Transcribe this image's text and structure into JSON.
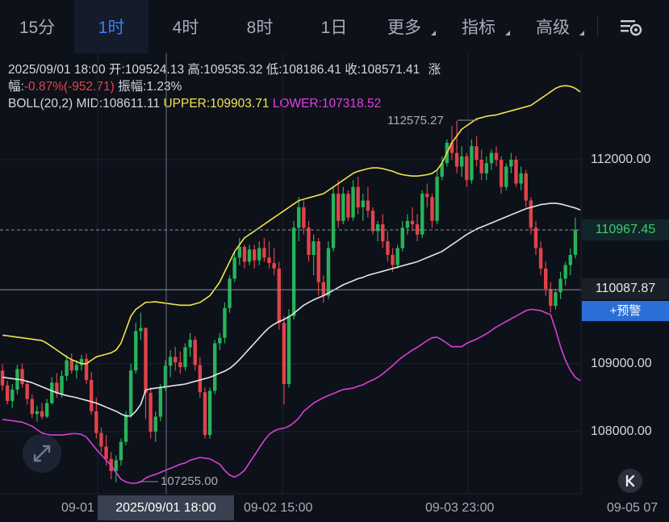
{
  "timeframes": [
    {
      "label": "15分",
      "active": false
    },
    {
      "label": "1时",
      "active": true
    },
    {
      "label": "4时",
      "active": false
    },
    {
      "label": "8时",
      "active": false
    },
    {
      "label": "1日",
      "active": false
    },
    {
      "label": "更多",
      "active": false,
      "dropdown": true
    },
    {
      "label": "指标",
      "active": false,
      "dropdown": true
    },
    {
      "label": "高级",
      "active": false,
      "dropdown": true
    }
  ],
  "info": {
    "line1_datetime": "2025/09/01 18:00",
    "open_label": "开:",
    "open": "109524.13",
    "high_label": "高:",
    "high": "109535.32",
    "low_label": "低:",
    "low": "108186.41",
    "close_label": "收:",
    "close": "108571.41",
    "change_label_a": "涨",
    "change_label_b": "幅:",
    "change_value": "-0.87%(-952.71)",
    "amplitude_label": "振幅:",
    "amplitude": "1.23%",
    "boll_label": "BOLL(20,2)",
    "mid_label": "MID:",
    "mid": "108611.11",
    "upper_label": "UPPER:",
    "upper": "109903.71",
    "lower_label": "LOWER:",
    "lower": "107318.52"
  },
  "price_tags": {
    "current": "110967.45",
    "crosshair": "110087.87",
    "alert_button": "+预警"
  },
  "chart_data": {
    "type": "candlestick",
    "y_ticks": [
      "112000.00",
      "109000.00",
      "108000.00"
    ],
    "y_tick_values": [
      112000,
      109000,
      108000
    ],
    "x_ticks": [
      "09-01",
      "09-02 15:00",
      "09-03 23:00",
      "09-05 07"
    ],
    "crosshair_x_label": "2025/09/01 18:00",
    "high_mark": "112575.27",
    "low_mark": "107255.00",
    "ylim": [
      107180,
      113200
    ],
    "colors": {
      "up": "#26b35a",
      "down": "#e0434a",
      "mid": "#e6e6e6",
      "upper": "#f2e44a",
      "lower": "#d93fd6",
      "grid": "#1e2430"
    },
    "candles": [
      [
        108900,
        108990,
        108600,
        108680
      ],
      [
        108680,
        108750,
        108400,
        108450
      ],
      [
        108450,
        108700,
        108350,
        108620
      ],
      [
        108620,
        108980,
        108550,
        108920
      ],
      [
        108920,
        109000,
        108650,
        108700
      ],
      [
        108700,
        108750,
        108400,
        108480
      ],
      [
        108480,
        108550,
        108200,
        108260
      ],
      [
        108260,
        108380,
        108150,
        108300
      ],
      [
        108300,
        108420,
        108180,
        108220
      ],
      [
        108220,
        108480,
        108200,
        108420
      ],
      [
        108420,
        108800,
        108400,
        108720
      ],
      [
        108720,
        108860,
        108500,
        108560
      ],
      [
        108560,
        108900,
        108500,
        108820
      ],
      [
        108820,
        109130,
        108750,
        109050
      ],
      [
        109050,
        109150,
        108850,
        108900
      ],
      [
        108900,
        109050,
        108780,
        108980
      ],
      [
        108980,
        109130,
        108900,
        109070
      ],
      [
        109070,
        109150,
        108700,
        108760
      ],
      [
        108760,
        108880,
        108250,
        108300
      ],
      [
        108300,
        108500,
        107900,
        107980
      ],
      [
        107980,
        108060,
        107700,
        107780
      ],
      [
        107780,
        107950,
        107500,
        107600
      ],
      [
        107600,
        107700,
        107300,
        107420
      ],
      [
        107420,
        107650,
        107255,
        107580
      ],
      [
        107580,
        107900,
        107500,
        107850
      ],
      [
        107850,
        108300,
        107800,
        108250
      ],
      [
        108250,
        109000,
        108200,
        108900
      ],
      [
        108900,
        109600,
        108850,
        109480
      ],
      [
        109480,
        109750,
        109350,
        109524
      ],
      [
        109524,
        109535,
        108186,
        108571
      ],
      [
        108571,
        108650,
        107900,
        108000
      ],
      [
        108000,
        108300,
        107850,
        108220
      ],
      [
        108220,
        108700,
        108150,
        108640
      ],
      [
        108640,
        109050,
        108600,
        108970
      ],
      [
        108970,
        109200,
        108800,
        109100
      ],
      [
        109100,
        109250,
        108900,
        109020
      ],
      [
        109020,
        109180,
        108850,
        108950
      ],
      [
        108950,
        109300,
        108900,
        109240
      ],
      [
        109240,
        109450,
        109100,
        109350
      ],
      [
        109350,
        109400,
        108900,
        108980
      ],
      [
        108980,
        109100,
        108500,
        108580
      ],
      [
        108580,
        108650,
        107900,
        107950
      ],
      [
        107950,
        108650,
        107900,
        108600
      ],
      [
        108600,
        109350,
        108550,
        109300
      ],
      [
        109300,
        109450,
        109200,
        109380
      ],
      [
        109380,
        109900,
        109300,
        109820
      ],
      [
        109820,
        110300,
        109750,
        110250
      ],
      [
        110250,
        110650,
        110200,
        110560
      ],
      [
        110560,
        110850,
        110450,
        110720
      ],
      [
        110720,
        110750,
        110400,
        110500
      ],
      [
        110500,
        110750,
        110450,
        110680
      ],
      [
        110680,
        110750,
        110400,
        110520
      ],
      [
        110520,
        110800,
        110450,
        110700
      ],
      [
        110700,
        110850,
        110500,
        110560
      ],
      [
        110560,
        110800,
        110400,
        110480
      ],
      [
        110480,
        110700,
        110300,
        110400
      ],
      [
        110400,
        110500,
        109500,
        109600
      ],
      [
        109600,
        109700,
        108400,
        108700
      ],
      [
        108700,
        109800,
        108650,
        109700
      ],
      [
        109700,
        111100,
        109650,
        111000
      ],
      [
        111000,
        111450,
        110800,
        111300
      ],
      [
        111300,
        111400,
        110900,
        111000
      ],
      [
        111000,
        111100,
        110500,
        110600
      ],
      [
        110600,
        110900,
        110300,
        110800
      ],
      [
        110800,
        110850,
        110000,
        110200
      ],
      [
        110200,
        110300,
        109900,
        110000
      ],
      [
        110000,
        110800,
        109950,
        110700
      ],
      [
        110700,
        111600,
        110650,
        111500
      ],
      [
        111500,
        111700,
        111000,
        111100
      ],
      [
        111100,
        111600,
        111050,
        111500
      ],
      [
        111500,
        111550,
        111100,
        111150
      ],
      [
        111150,
        111700,
        111100,
        111600
      ],
      [
        111600,
        111750,
        111200,
        111300
      ],
      [
        111300,
        111500,
        111100,
        111400
      ],
      [
        111400,
        111600,
        111150,
        111250
      ],
      [
        111250,
        111300,
        110900,
        110950
      ],
      [
        110950,
        111100,
        110800,
        111050
      ],
      [
        111050,
        111200,
        110700,
        110800
      ],
      [
        110800,
        110950,
        110500,
        110600
      ],
      [
        110600,
        110700,
        110350,
        110450
      ],
      [
        110450,
        110750,
        110400,
        110700
      ],
      [
        110700,
        111100,
        110650,
        111000
      ],
      [
        111000,
        111200,
        110900,
        111100
      ],
      [
        111100,
        111300,
        110950,
        111050
      ],
      [
        111050,
        111200,
        110800,
        110900
      ],
      [
        110900,
        111550,
        110850,
        111500
      ],
      [
        111500,
        111650,
        111300,
        111450
      ],
      [
        111450,
        111500,
        111000,
        111100
      ],
      [
        111100,
        111850,
        111050,
        111750
      ],
      [
        111750,
        112050,
        111700,
        111950
      ],
      [
        111950,
        112300,
        111900,
        112250
      ],
      [
        112250,
        112500,
        112000,
        112100
      ],
      [
        112100,
        112575,
        111800,
        111900
      ],
      [
        111900,
        112200,
        111750,
        112050
      ],
      [
        112050,
        112100,
        111600,
        111700
      ],
      [
        111700,
        112300,
        111650,
        112200
      ],
      [
        112200,
        112350,
        111900,
        112000
      ],
      [
        112000,
        112150,
        111700,
        111800
      ],
      [
        111800,
        112050,
        111700,
        111950
      ],
      [
        111950,
        112150,
        111850,
        112100
      ],
      [
        112100,
        112200,
        111900,
        112000
      ],
      [
        112000,
        112050,
        111500,
        111600
      ],
      [
        111600,
        111950,
        111550,
        111900
      ],
      [
        111900,
        112100,
        111800,
        112000
      ],
      [
        112000,
        112050,
        111600,
        111650
      ],
      [
        111650,
        111900,
        111550,
        111800
      ],
      [
        111800,
        111850,
        111300,
        111400
      ],
      [
        111400,
        111450,
        110900,
        111000
      ],
      [
        111000,
        111100,
        110600,
        110700
      ],
      [
        110700,
        110800,
        110300,
        110400
      ],
      [
        110400,
        110500,
        110000,
        110100
      ],
      [
        110100,
        110200,
        109750,
        109850
      ],
      [
        109850,
        110100,
        109800,
        110050
      ],
      [
        110050,
        110350,
        109950,
        110250
      ],
      [
        110250,
        110500,
        110150,
        110450
      ],
      [
        110450,
        110700,
        110300,
        110600
      ],
      [
        110600,
        111150,
        110550,
        110967
      ]
    ],
    "mid": [
      108800,
      108790,
      108780,
      108770,
      108760,
      108740,
      108720,
      108690,
      108660,
      108630,
      108600,
      108575,
      108550,
      108530,
      108515,
      108500,
      108480,
      108460,
      108440,
      108420,
      108390,
      108360,
      108330,
      108300,
      108260,
      108230,
      108230,
      108300,
      108400,
      108611,
      108630,
      108640,
      108650,
      108660,
      108670,
      108680,
      108690,
      108700,
      108720,
      108740,
      108760,
      108780,
      108800,
      108830,
      108860,
      108890,
      108930,
      108990,
      109060,
      109140,
      109220,
      109300,
      109380,
      109460,
      109530,
      109580,
      109620,
      109650,
      109690,
      109740,
      109800,
      109860,
      109900,
      109940,
      109970,
      110000,
      110040,
      110080,
      110120,
      110160,
      110190,
      110220,
      110250,
      110270,
      110300,
      110320,
      110340,
      110360,
      110380,
      110400,
      110420,
      110440,
      110460,
      110480,
      110500,
      110530,
      110560,
      110590,
      110620,
      110650,
      110700,
      110750,
      110800,
      110850,
      110900,
      110940,
      110980,
      111010,
      111040,
      111070,
      111100,
      111130,
      111160,
      111190,
      111220,
      111250,
      111280,
      111300,
      111320,
      111340,
      111350,
      111360,
      111360,
      111350,
      111330,
      111310,
      111290,
      111260
    ],
    "upper": [
      109420,
      109410,
      109400,
      109390,
      109380,
      109370,
      109360,
      109350,
      109340,
      109300,
      109250,
      109200,
      109150,
      109100,
      109060,
      109030,
      109000,
      109000,
      109050,
      109100,
      109120,
      109140,
      109160,
      109200,
      109300,
      109500,
      109700,
      109800,
      109850,
      109903,
      109905,
      109910,
      109900,
      109890,
      109880,
      109870,
      109860,
      109860,
      109860,
      109880,
      109900,
      109950,
      110000,
      110100,
      110200,
      110350,
      110500,
      110650,
      110750,
      110850,
      110900,
      110950,
      111000,
      111050,
      111100,
      111150,
      111200,
      111250,
      111300,
      111350,
      111400,
      111420,
      111440,
      111460,
      111480,
      111500,
      111550,
      111600,
      111650,
      111700,
      111750,
      111800,
      111830,
      111850,
      111870,
      111880,
      111880,
      111870,
      111850,
      111830,
      111800,
      111780,
      111770,
      111760,
      111760,
      111770,
      111780,
      111800,
      111850,
      111950,
      112100,
      112250,
      112350,
      112450,
      112500,
      112550,
      112600,
      112620,
      112640,
      112650,
      112660,
      112680,
      112700,
      112720,
      112740,
      112760,
      112780,
      112800,
      112850,
      112900,
      112950,
      113000,
      113050,
      113080,
      113090,
      113080,
      113050,
      113000
    ],
    "lower": [
      108180,
      108170,
      108160,
      108150,
      108140,
      108110,
      108080,
      108030,
      107980,
      107960,
      107950,
      107950,
      107950,
      107960,
      107970,
      107970,
      107960,
      107920,
      107830,
      107740,
      107660,
      107580,
      107500,
      107400,
      107300,
      107260,
      107240,
      107240,
      107260,
      107318,
      107350,
      107370,
      107400,
      107430,
      107460,
      107490,
      107520,
      107540,
      107580,
      107600,
      107620,
      107610,
      107600,
      107560,
      107520,
      107430,
      107360,
      107330,
      107370,
      107430,
      107540,
      107650,
      107760,
      107870,
      107960,
      108010,
      108040,
      108050,
      108080,
      108130,
      108200,
      108300,
      108360,
      108420,
      108460,
      108500,
      108530,
      108560,
      108590,
      108620,
      108630,
      108640,
      108670,
      108690,
      108730,
      108760,
      108800,
      108850,
      108910,
      108970,
      109040,
      109100,
      109150,
      109200,
      109240,
      109290,
      109340,
      109380,
      109390,
      109350,
      109300,
      109250,
      109250,
      109250,
      109300,
      109330,
      109360,
      109400,
      109440,
      109490,
      109540,
      109580,
      109620,
      109660,
      109700,
      109740,
      109780,
      109800,
      109790,
      109780,
      109750,
      109720,
      109500,
      109250,
      109050,
      108900,
      108800,
      108750
    ]
  }
}
